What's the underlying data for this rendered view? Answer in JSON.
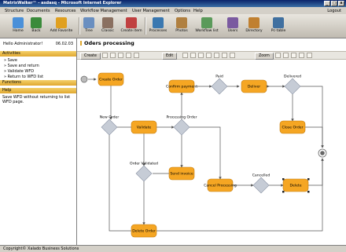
{
  "window": {
    "title": "MatrixWalker™ - asdasq - Microsoft Internet Explorer"
  },
  "menu": {
    "items": [
      "Structure",
      "Documents",
      "Resources",
      "Workflow Management",
      "User Management",
      "Options",
      "Help"
    ],
    "logout": "Logout"
  },
  "toolbar": {
    "buttons": [
      {
        "label": "Home",
        "icon": "home-icon",
        "color": "#4a90d9"
      },
      {
        "label": "Back",
        "icon": "back-icon",
        "color": "#3b8b3b"
      },
      {
        "label": "Add Favorite",
        "icon": "star-icon",
        "color": "#e0a020"
      },
      {
        "label": "Tree",
        "icon": "tree-icon",
        "color": "#6a8fc0"
      },
      {
        "label": "Classic",
        "icon": "classic-icon",
        "color": "#8a7060"
      },
      {
        "label": "Create item",
        "icon": "create-item-icon",
        "color": "#c04040"
      },
      {
        "label": "Processes",
        "icon": "processes-icon",
        "color": "#3a78b0"
      },
      {
        "label": "Photos",
        "icon": "photos-icon",
        "color": "#b08040"
      },
      {
        "label": "Workflow list",
        "icon": "workflow-icon",
        "color": "#5a9a5a"
      },
      {
        "label": "Users",
        "icon": "users-icon",
        "color": "#7a5aa0"
      },
      {
        "label": "Directory",
        "icon": "directory-icon",
        "color": "#c08030"
      },
      {
        "label": "Pc-table",
        "icon": "pc-table-icon",
        "color": "#4070a0"
      }
    ]
  },
  "sidebar": {
    "user": "Hello Administrator!",
    "date": "06.02.03",
    "activities_title": "Activities",
    "activities": [
      "» Save",
      "» Save and return",
      "» Validate WFD",
      "» Return to WFD list"
    ],
    "functions_title": "Functions",
    "help_title": "Help",
    "help_text": "Save WFD without returning to list WFD page."
  },
  "main": {
    "title": "Oders processing",
    "create": "Create",
    "edit": "Edit",
    "zoom": "Zoom"
  },
  "diagram": {
    "colors": {
      "task": "#f5a623",
      "gateway": "#c6ccd6",
      "line": "#555555"
    },
    "tasks": [
      "Create Order",
      "Validate",
      "Confirm payment",
      "Deliver",
      "Close Order",
      "Send invoice",
      "Cancel Processing",
      "Delete",
      "Delete Order"
    ],
    "gateways": [
      "New Order",
      "Processing Order",
      "Paid",
      "Delivered",
      "Order Validated",
      "Cancelled"
    ]
  },
  "status": {
    "text": "Copyright© Xalado Business Solutions"
  }
}
